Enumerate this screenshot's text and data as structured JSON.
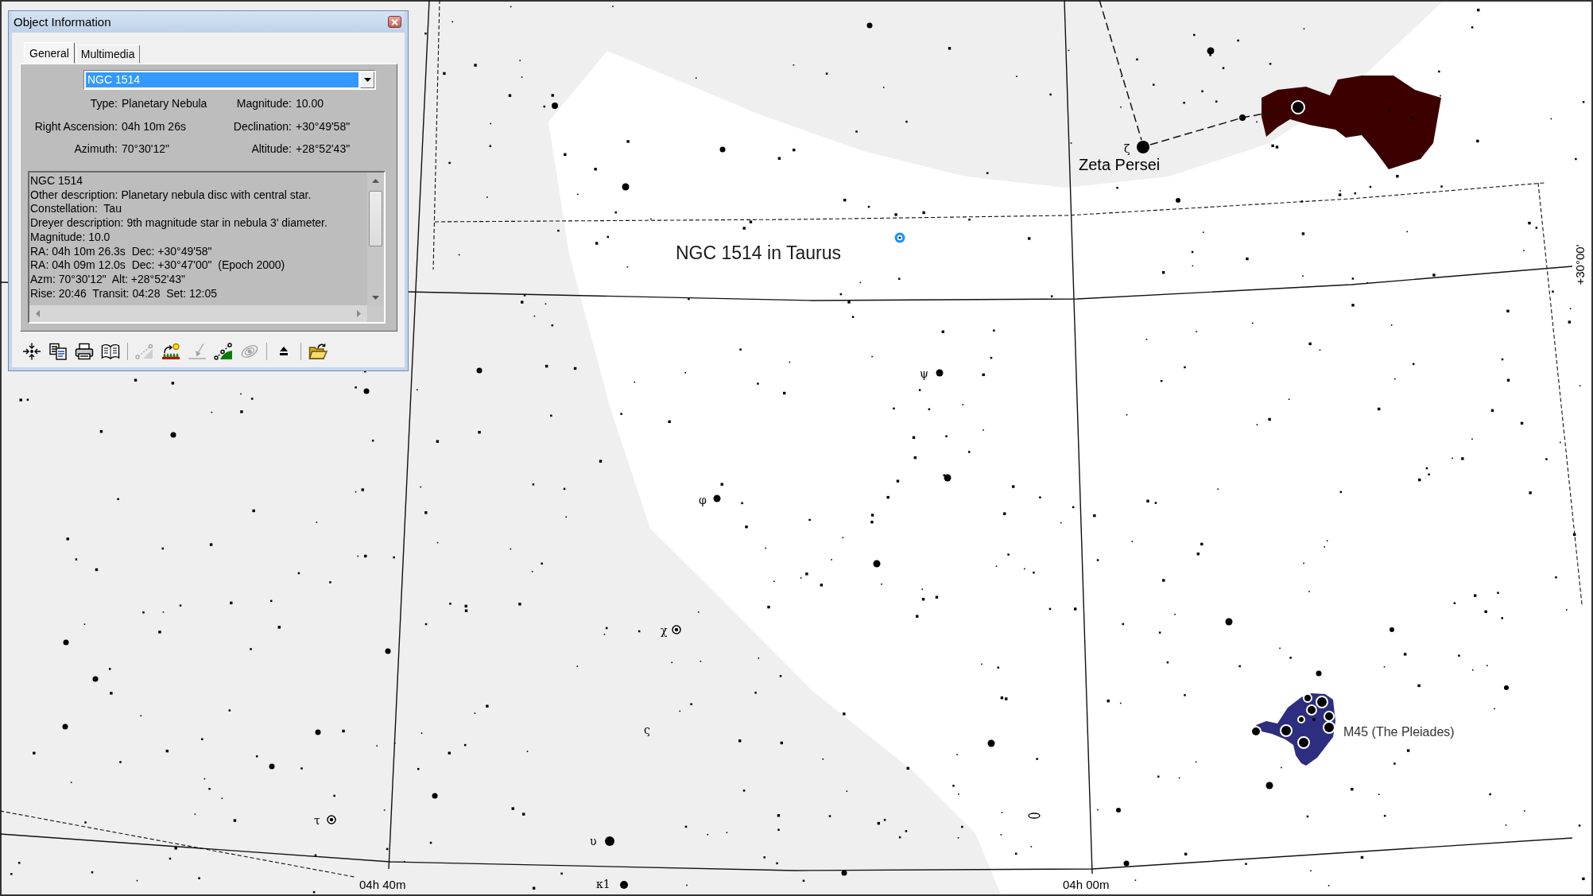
{
  "window": {
    "title": "Object Information"
  },
  "tabs": [
    {
      "label": "General",
      "selected": true
    },
    {
      "label": "Multimedia",
      "selected": false
    }
  ],
  "object_select": {
    "value": "NGC 1514"
  },
  "properties": [
    {
      "label": "Type:",
      "value": "Planetary Nebula"
    },
    {
      "label": "Magnitude:",
      "value": "10.00"
    },
    {
      "label": "Right Ascension:",
      "value": "04h 10m 26s"
    },
    {
      "label": "Declination:",
      "value": "+30°49'58\""
    },
    {
      "label": "Azimuth:",
      "value": "70°30'12\""
    },
    {
      "label": "Altitude:",
      "value": "+28°52'43\""
    }
  ],
  "description": {
    "lines": [
      "NGC 1514",
      "Other description: Planetary nebula disc with central star.",
      "Constellation:  Tau",
      "Dreyer description: 9th magnitude star in nebula 3' diameter.",
      "Magnitude: 10.0",
      "RA: 04h 10m 26.3s  Dec: +30°49'58\"",
      "RA: 04h 09m 12.0s  Dec: +30°47'00\"  (Epoch 2000)",
      "Azm: 70°30'12\"  Alt: +28°52'43\"",
      "Rise: 20:46  Transit: 04:28  Set: 12:05"
    ]
  },
  "toolbar": [
    {
      "buttons": [
        {
          "disabled": false
        },
        {
          "disabled": false
        },
        {
          "disabled": false
        },
        {
          "disabled": false
        }
      ]
    },
    {
      "buttons": [
        {
          "disabled": true
        },
        {
          "disabled": false
        },
        {
          "disabled": true
        },
        {
          "disabled": false
        },
        {
          "disabled": true
        }
      ]
    },
    {
      "buttons": [
        {
          "disabled": false
        }
      ]
    },
    {
      "buttons": [
        {
          "disabled": false
        }
      ]
    }
  ],
  "sky_chart": {
    "object_labels": [
      "Zeta Persei",
      "M45 (The Pleiades)"
    ],
    "annotation": "NGC 1514 in Taurus",
    "star_labels": [
      "ζ",
      "ψ",
      "φ",
      "χ",
      "ς",
      "τ",
      "υ",
      "κ1"
    ],
    "ra_labels": [
      "04h 40m",
      "04h 00m"
    ],
    "dec_labels": [
      "+30°00'"
    ]
  }
}
